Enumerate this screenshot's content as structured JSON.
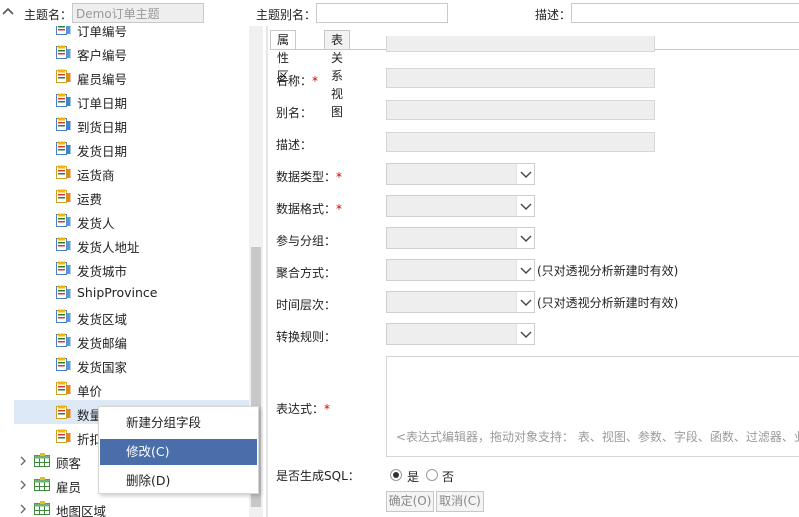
{
  "topbar": {
    "theme_name_label": "主题名：",
    "theme_name_value": "Demo订单主题",
    "theme_alias_label": "主题别名：",
    "theme_alias_value": "",
    "desc_label": "描述：",
    "desc_value": ""
  },
  "tree": {
    "fields": [
      {
        "label": "订单编号",
        "icon": "field-text-icon"
      },
      {
        "label": "客户编号",
        "icon": "field-text-icon"
      },
      {
        "label": "雇员编号",
        "icon": "field-number-icon"
      },
      {
        "label": "订单日期",
        "icon": "field-date-icon"
      },
      {
        "label": "到货日期",
        "icon": "field-date-icon"
      },
      {
        "label": "发货日期",
        "icon": "field-date-icon"
      },
      {
        "label": "运货商",
        "icon": "field-number-icon"
      },
      {
        "label": "运费",
        "icon": "field-number-icon"
      },
      {
        "label": "发货人",
        "icon": "field-text-icon"
      },
      {
        "label": "发货人地址",
        "icon": "field-text-icon"
      },
      {
        "label": "发货城市",
        "icon": "field-text-icon"
      },
      {
        "label": "ShipProvince",
        "icon": "field-text-icon"
      },
      {
        "label": "发货区域",
        "icon": "field-text-icon"
      },
      {
        "label": "发货邮编",
        "icon": "field-text-icon"
      },
      {
        "label": "发货国家",
        "icon": "field-text-icon"
      },
      {
        "label": "单价",
        "icon": "field-number-icon"
      },
      {
        "label": "数量",
        "icon": "field-number-icon"
      },
      {
        "label": "折扣",
        "icon": "field-number-icon"
      }
    ],
    "tables": [
      {
        "label": "顾客"
      },
      {
        "label": "雇员"
      },
      {
        "label": "地图区域"
      }
    ]
  },
  "context_menu": {
    "items": [
      "新建分组字段",
      "修改(C)",
      "删除(D)"
    ],
    "highlighted_index": 1
  },
  "tabs": [
    "属性区",
    "表关系视图"
  ],
  "form": {
    "name_label": "名称：",
    "alias_label": "别名：",
    "desc_label": "描述：",
    "datatype_label": "数据类型：",
    "dataformat_label": "数据格式：",
    "group_label": "参与分组：",
    "agg_label": "聚合方式：",
    "time_label": "时间层次：",
    "convert_label": "转换规则：",
    "expr_label": "表达式：",
    "required_mark": "*",
    "pivot_note": "(只对透视分析新建时有效)",
    "expr_placeholder": "<表达式编辑器，拖动对象支持： 表、视图、参数、字段、函数、过滤器、业",
    "sql_label": "是否生成SQL：",
    "sql_yes": "是",
    "sql_no": "否",
    "sql_selected": "是",
    "ok_button": "确定(O)",
    "cancel_button": "取消(C)"
  },
  "colors": {
    "menu_highlight": "#4a6ea9",
    "required": "#d40000",
    "selected_row": "#dde9f6"
  }
}
